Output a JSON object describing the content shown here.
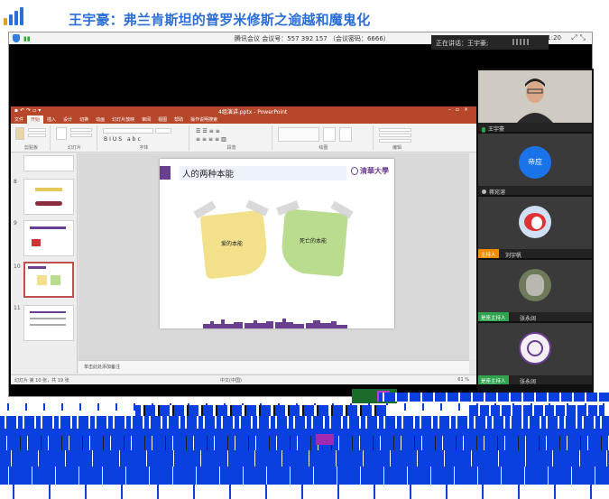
{
  "header": {
    "title": "王宇豪：弗兰肯斯坦的普罗米修斯之逾越和魔鬼化"
  },
  "meeting": {
    "titlebar_text": "腾讯会议 会议号：557 392 157 （会议密码：6666）",
    "timer": "01:01:20",
    "speaking_label": "正在讲话：王宇豪;"
  },
  "ppt": {
    "filename": "4组演讲.pptx - PowerPoint",
    "tabs": [
      "文件",
      "开始",
      "插入",
      "设计",
      "切换",
      "动画",
      "幻灯片放映",
      "审阅",
      "视图",
      "帮助",
      "操作说明搜索"
    ],
    "ribbon_groups": [
      "剪贴板",
      "幻灯片",
      "字体",
      "段落",
      "绘图",
      "编辑"
    ],
    "thumb_numbers": [
      "8",
      "9",
      "10",
      "11"
    ],
    "slide": {
      "title": "人的两种本能",
      "logo_text": "清華大學",
      "note_left": "爱的本能",
      "note_right": "死亡的本能"
    },
    "notes_placeholder": "单击此处添加备注",
    "status_left": "幻灯片 第 10 张，共 19 张",
    "status_mid": "中文(中国)",
    "status_zoom": "61 %"
  },
  "participants": [
    {
      "name": "王宇豪",
      "role": "",
      "avatar": "video"
    },
    {
      "name": "蒋宛溶",
      "role": "",
      "avatar": "text",
      "avatar_text": "帝应"
    },
    {
      "name": "刘宇帆",
      "role": "主持人",
      "avatar": "photo"
    },
    {
      "name": "张永阔",
      "role": "是座主持人",
      "avatar": "photo"
    },
    {
      "name": "张永阔",
      "role": "是座主持人",
      "avatar": "seal"
    }
  ],
  "colors": {
    "title_blue": "#2b6fd6",
    "ppt_red": "#b7472a",
    "host_green": "#2ea44f",
    "host_orange": "#f08c00",
    "avatar_blue": "#1a73e8"
  }
}
